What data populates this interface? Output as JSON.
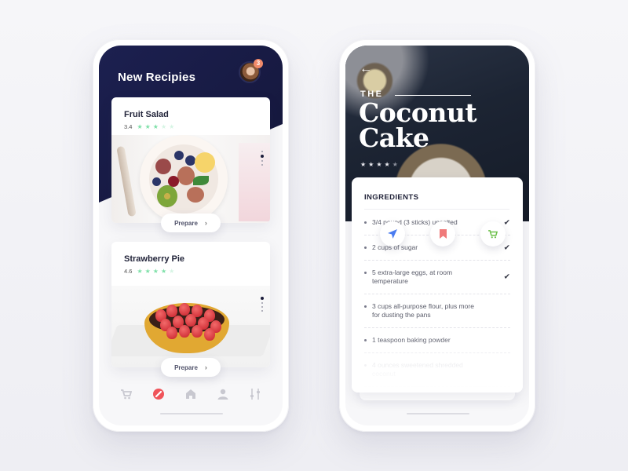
{
  "left_screen": {
    "title": "New Recipies",
    "notification_count": "3",
    "recipes": [
      {
        "name": "Fruit Salad",
        "rating": "3.4",
        "stars_filled": 3,
        "stars_total": 5,
        "button_label": "Prepare",
        "image": "fruit-salad-photo",
        "carousel_index": 2,
        "carousel_total": 4
      },
      {
        "name": "Strawberry Pie",
        "rating": "4.6",
        "stars_filled": 4,
        "stars_total": 5,
        "button_label": "Prepare",
        "image": "strawberry-pie-photo",
        "carousel_index": 1,
        "carousel_total": 4
      }
    ],
    "bottom_nav": [
      {
        "name": "cart",
        "icon": "cart-icon",
        "active": false
      },
      {
        "name": "explore",
        "icon": "compass-icon",
        "active": true
      },
      {
        "name": "home",
        "icon": "home-icon",
        "active": false
      },
      {
        "name": "profile",
        "icon": "user-icon",
        "active": false
      },
      {
        "name": "filters",
        "icon": "sliders-icon",
        "active": false
      }
    ]
  },
  "right_screen": {
    "back_icon": "arrow-left-icon",
    "title_prefix": "THE",
    "title_line1": "Coconut",
    "title_line2": "Cake",
    "stars_filled": 4,
    "stars_total": 5,
    "ingredients_heading": "INGREDIENTS",
    "ingredients": [
      {
        "text": "3/4 pound (3 sticks) unsalted",
        "checked": true
      },
      {
        "text": "2 cups of sugar",
        "checked": true
      },
      {
        "text": "5 extra-large eggs, at room temperature",
        "checked": true
      },
      {
        "text": "3 cups all-purpose flour, plus more for dusting the pans",
        "checked": false
      },
      {
        "text": "1 teaspoon baking powder",
        "checked": false
      },
      {
        "text": "4 ounces sweetened shredded coconut",
        "checked": false
      },
      {
        "text": "4 ounces sweetened shredded",
        "checked": false
      }
    ],
    "actions": [
      {
        "name": "share",
        "icon": "send-icon",
        "color": "#4a7cf0"
      },
      {
        "name": "bookmark",
        "icon": "bookmark-icon",
        "color": "#f07a7a"
      },
      {
        "name": "add-to-cart",
        "icon": "cart-icon",
        "color": "#6cc04a"
      }
    ]
  },
  "colors": {
    "header_navy": "#1c2050",
    "star_green": "#7ee0a8",
    "accent_red": "#f0545a",
    "badge_orange": "#f08a6a"
  },
  "glyphs": {
    "star": "★",
    "chevron_right": "›",
    "check": "✔",
    "back_arrow": "←"
  }
}
